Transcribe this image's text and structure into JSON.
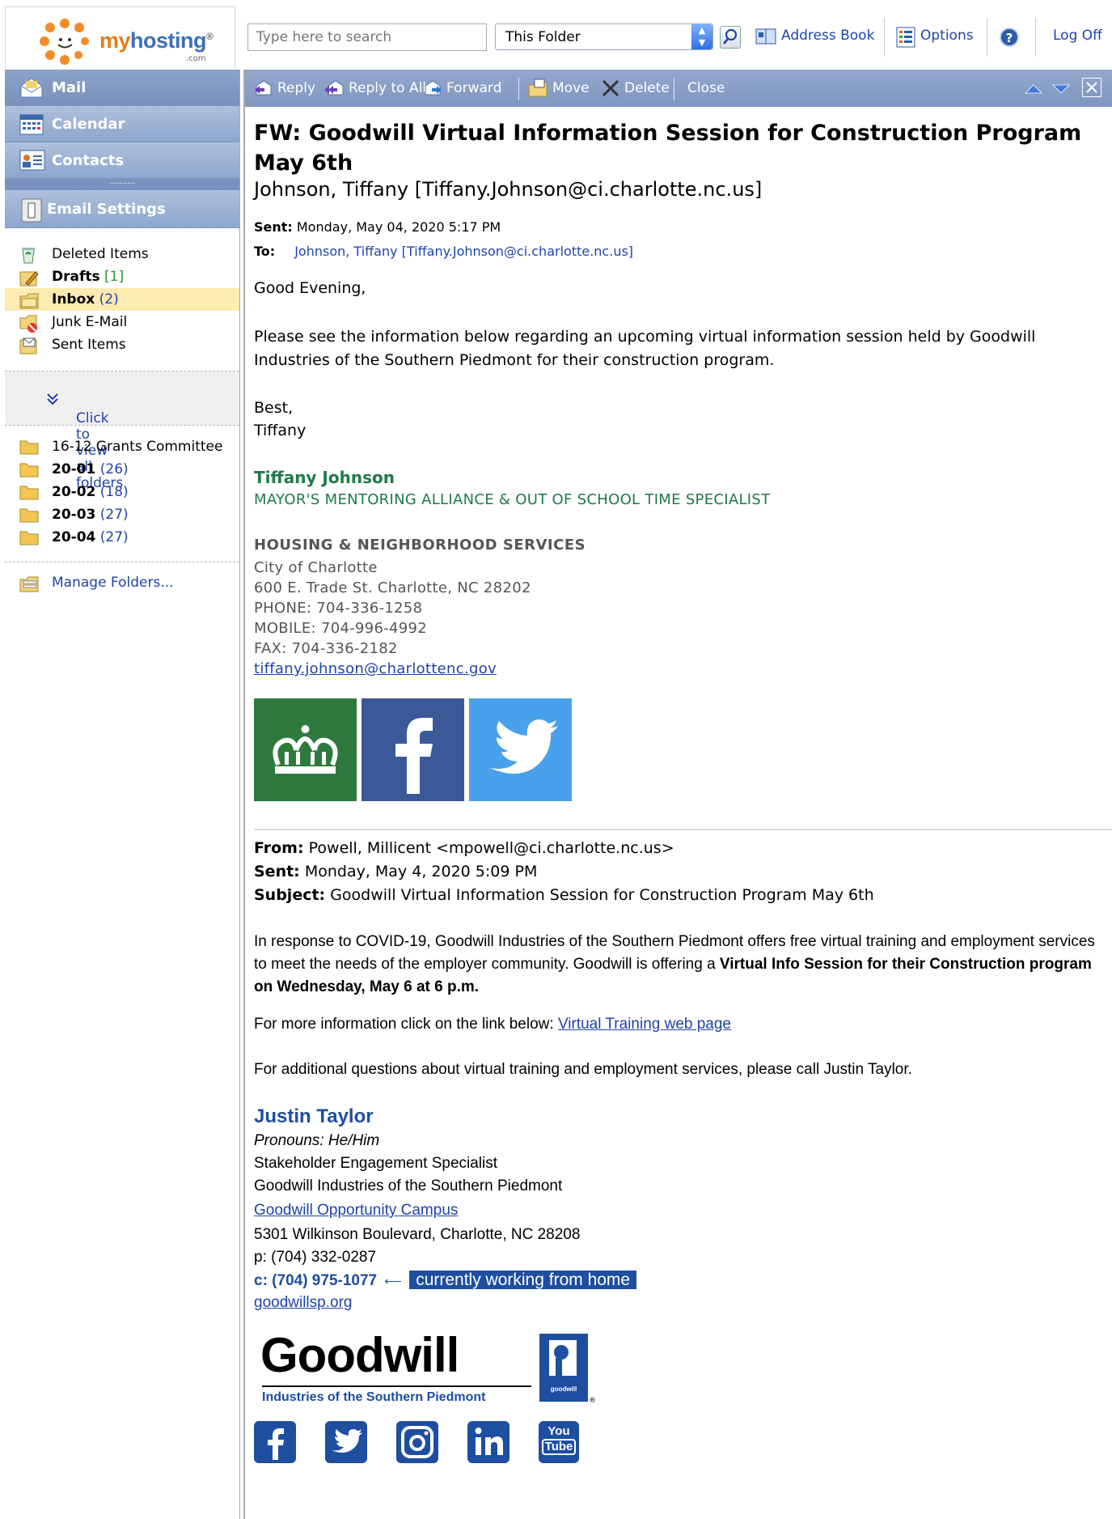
{
  "topbar": {
    "logo_brand_prefix": "my",
    "logo_brand_suffix": "hosting",
    "logo_reg": "®",
    "logo_com": ".com",
    "search_placeholder": "Type here to search",
    "scope_value": "This Folder",
    "address_book": "Address Book",
    "options": "Options",
    "log_off": "Log Off"
  },
  "nav": {
    "mail": "Mail",
    "calendar": "Calendar",
    "contacts": "Contacts",
    "grip": "..........",
    "email_settings": "Email Settings"
  },
  "folders": [
    {
      "name": "Deleted Items",
      "count": "",
      "bold": false
    },
    {
      "name": "Drafts",
      "count": "[1]",
      "bold": true
    },
    {
      "name": "Inbox",
      "count": "(2)",
      "bold": true
    },
    {
      "name": "Junk E-Mail",
      "count": "",
      "bold": false
    },
    {
      "name": "Sent Items",
      "count": "",
      "bold": false
    }
  ],
  "view_all": "Click to view all folders",
  "custom_folders": [
    {
      "name": "16-12 Grants Committee",
      "count": ""
    },
    {
      "name": "20-01",
      "count": "(26)"
    },
    {
      "name": "20-02",
      "count": "(18)"
    },
    {
      "name": "20-03",
      "count": "(27)"
    },
    {
      "name": "20-04",
      "count": "(27)"
    }
  ],
  "manage_folders": "Manage Folders...",
  "toolbar": {
    "reply": "Reply",
    "reply_all": "Reply to All",
    "forward": "Forward",
    "move": "Move",
    "delete": "Delete",
    "close": "Close"
  },
  "message": {
    "subject": "FW: Goodwill Virtual Information Session for Construction Program May 6th",
    "from": "Johnson, Tiffany [Tiffany.Johnson@ci.charlotte.nc.us]",
    "sent_label": "Sent:",
    "sent_value": "Monday, May 04, 2020 5:17 PM",
    "to_label": "To:",
    "to_value": "Johnson, Tiffany [Tiffany.Johnson@ci.charlotte.nc.us]",
    "greeting": "Good Evening,",
    "para1": "Please see the information below regarding an upcoming virtual information session held by Goodwill Industries of the Southern Piedmont for their construction program.",
    "best": "Best,",
    "name_short": "Tiffany",
    "sig_name": "Tiffany Johnson",
    "sig_title": "MAYOR'S MENTORING ALLIANCE & OUT OF SCHOOL TIME SPECIALIST",
    "sig_dept": "HOUSING & NEIGHBORHOOD SERVICES",
    "sig_lines": [
      "City of Charlotte",
      "600 E. Trade St. Charlotte, NC 28202",
      "PHONE: 704-336-1258",
      "MOBILE: 704-996-4992",
      "FAX: 704-336-2182"
    ],
    "sig_email": "tiffany.johnson@charlottenc.gov",
    "fw_from_label": "From:",
    "fw_from_value": "Powell, Millicent <mpowell@ci.charlotte.nc.us>",
    "fw_sent_label": "Sent:",
    "fw_sent_value": "Monday, May 4, 2020 5:09 PM",
    "fw_subject_label": "Subject:",
    "fw_subject_value": "Goodwill Virtual Information Session for Construction Program May 6th",
    "fw_para1_a": "In response to COVID-19, Goodwill Industries of the Southern Piedmont offers free virtual training and employment services to meet the needs of the employer community. Goodwill is offering a ",
    "fw_para1_b": "Virtual Info Session for their Construction program on Wednesday, May 6 at 6 p.m.",
    "fw_para2": "For more information click on the link below: ",
    "fw_para2_link": "Virtual Training web page",
    "fw_para3": "For additional questions about virtual training and employment services, please call Justin Taylor.",
    "jt_name": "Justin Taylor",
    "jt_pronouns": "Pronouns: He/Him",
    "jt_title": "Stakeholder Engagement Specialist",
    "jt_org": "Goodwill Industries of the Southern Piedmont",
    "jt_campus": "Goodwill Opportunity Campus",
    "jt_address": "5301 Wilkinson Boulevard, Charlotte, NC 28208",
    "jt_phone": "p: (704) 332-0287",
    "jt_cell": "c: (704) 975-1077",
    "jt_arrow": "⟵",
    "jt_home": "currently working from home",
    "jt_site": "goodwillsp.org",
    "gw_logo_word": "Goodwill",
    "gw_logo_sub": "Industries of the Southern Piedmont",
    "gw_badge_text": "goodwill",
    "gw_badge_reg": "®",
    "yt_you": "You",
    "yt_tube": "Tube"
  },
  "colors": {
    "nav_blue": "#8ea6cc",
    "link_blue": "#1f44a8",
    "sig_green": "#1e7a4a",
    "goodwill_blue": "#1e4ea0",
    "selected_row": "#fcecb2"
  }
}
